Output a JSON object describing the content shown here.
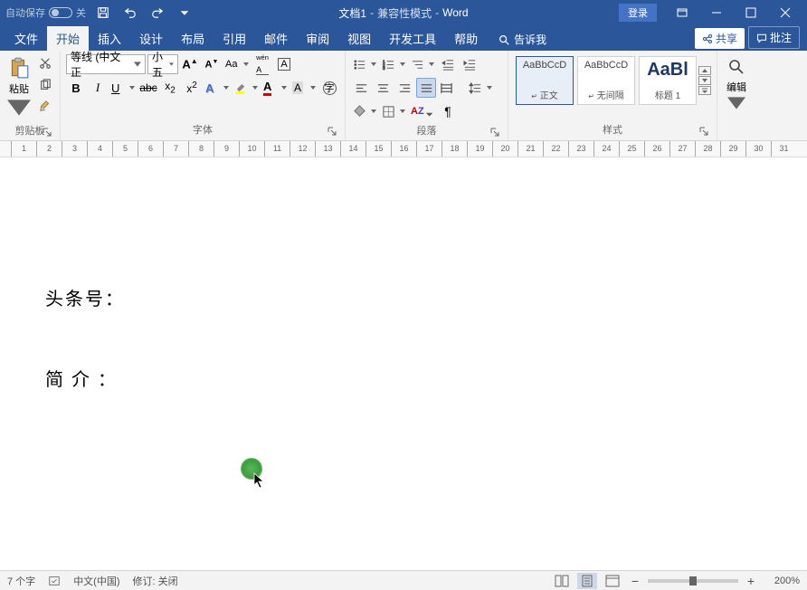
{
  "title": {
    "autosave_label": "自动保存",
    "autosave_state": "关",
    "doc_name": "文档1",
    "compat_mode": "兼容性模式",
    "app_name": "Word",
    "login": "登录"
  },
  "tabs": {
    "file": "文件",
    "home": "开始",
    "insert": "插入",
    "design": "设计",
    "layout": "布局",
    "references": "引用",
    "mailings": "邮件",
    "review": "审阅",
    "view": "视图",
    "developer": "开发工具",
    "help": "帮助",
    "tellme": "告诉我",
    "share": "共享",
    "comments": "批注"
  },
  "ribbon": {
    "clipboard": {
      "paste": "粘贴",
      "label": "剪贴板"
    },
    "font": {
      "name": "等线 (中文正",
      "size": "小五",
      "label": "字体"
    },
    "paragraph": {
      "label": "段落"
    },
    "styles": {
      "preview1": "AaBbCcD",
      "preview2": "AaBbCcD",
      "preview3": "AaBl",
      "name1": "正文",
      "name2": "无间隔",
      "name3": "标题 1",
      "label": "样式"
    },
    "editing": {
      "label": "编辑"
    }
  },
  "document": {
    "line1": "头条号：",
    "line2": "简 介 ："
  },
  "statusbar": {
    "word_count": "7 个字",
    "language": "中文(中国)",
    "track_changes": "修订: 关闭",
    "zoom": "200%"
  }
}
